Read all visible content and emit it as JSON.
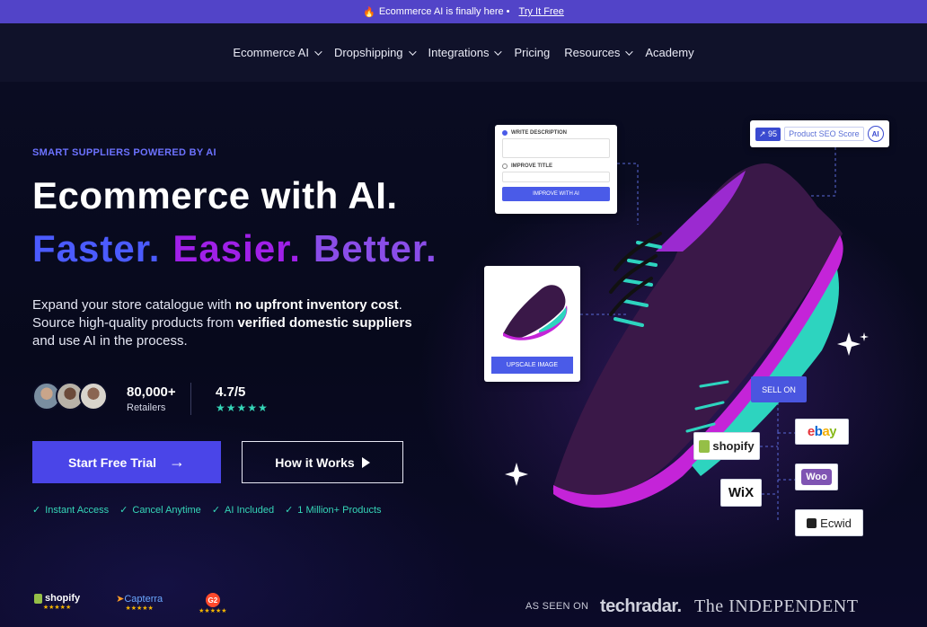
{
  "announcement": {
    "text": "Ecommerce AI is finally here •",
    "link": "Try It Free"
  },
  "nav": {
    "items": [
      {
        "label": "Ecommerce AI",
        "dropdown": true
      },
      {
        "label": "Dropshipping",
        "dropdown": true
      },
      {
        "label": "Integrations",
        "dropdown": true
      },
      {
        "label": "Pricing",
        "dropdown": false
      },
      {
        "label": "Resources",
        "dropdown": true
      },
      {
        "label": "Academy",
        "dropdown": false
      }
    ]
  },
  "hero": {
    "kicker": "SMART  SUPPLIERS  POWERED BY AI",
    "headline": "Ecommerce with AI.",
    "subheadline": [
      "Faster.",
      "Easier.",
      "Better."
    ],
    "description": {
      "p1": "Expand your store catalogue with ",
      "b1": "no upfront inventory cost",
      "p2": ". Source high-quality products from ",
      "b2": "verified domestic suppliers",
      "p3": " and use AI in the process."
    },
    "stat_retailers": {
      "value": "80,000+",
      "label": "Retailers"
    },
    "stat_rating": {
      "value": "4.7/5",
      "stars": "★★★★★"
    },
    "cta_primary": "Start Free Trial",
    "cta_secondary": "How it Works",
    "checks": [
      "Instant Access",
      "Cancel Anytime",
      "AI Included",
      "1 Million+ Products"
    ]
  },
  "visual": {
    "write_description": "WRITE DESCRIPTION",
    "improve_title": "IMPROVE TITLE",
    "improve_with_ai": "IMPROVE WITH AI",
    "seo_score": "95",
    "seo_label": "Product SEO Score",
    "seo_ai": "AI",
    "upscale": "UPSCALE IMAGE",
    "sell_on": "SELL ON",
    "marketplaces": {
      "shopify": "shopify",
      "ebay": "ebay",
      "wix": "WiX",
      "woo": "Woo",
      "ecwid": "Ecwid"
    }
  },
  "footer": {
    "badges": [
      {
        "name": "shopify",
        "stars": "★★★★★"
      },
      {
        "name": "Capterra",
        "stars": "★★★★★"
      },
      {
        "name": "G2",
        "stars": "★★★★★"
      }
    ],
    "as_seen_on": "AS SEEN ON",
    "press1": "techradar.",
    "press2": "The INDEPENDENT"
  },
  "colors": {
    "accent": "#4a45e8",
    "announce_bg": "#5244c8",
    "teal": "#35d6b8",
    "purple": "#a020e8"
  }
}
